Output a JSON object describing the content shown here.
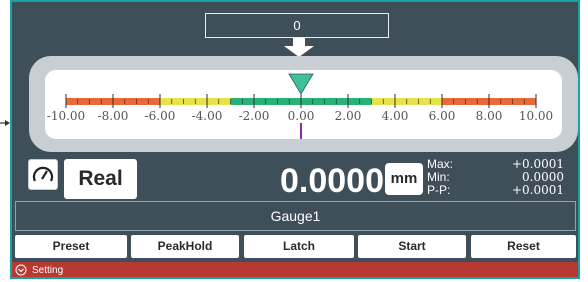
{
  "top_value": "0",
  "scale": {
    "min": -10,
    "max": 10,
    "major_ticks": [
      "-10.00",
      "-8.00",
      "-6.00",
      "-4.00",
      "-2.00",
      "0.00",
      "2.00",
      "4.00",
      "6.00",
      "8.00",
      "10.00"
    ],
    "zones": [
      {
        "from": -10,
        "to": -6,
        "color": "#e86a3a"
      },
      {
        "from": -6,
        "to": -3,
        "color": "#e6e24a"
      },
      {
        "from": -3,
        "to": 3,
        "color": "#28b27a"
      },
      {
        "from": 3,
        "to": 6,
        "color": "#e6e24a"
      },
      {
        "from": 6,
        "to": 10,
        "color": "#e86a3a"
      }
    ],
    "pointer_value": 0,
    "pointer_color": "#3fbf9a",
    "marker_color": "#8a2aa0"
  },
  "mode_label": "Real",
  "reading": "0.0000",
  "unit": "mm",
  "stats": {
    "max_label": "Max:",
    "max_value": "+0.0001",
    "min_label": "Min:",
    "min_value": "0.0000",
    "pp_label": "P-P:",
    "pp_value": "+0.0001"
  },
  "gauge_name": "Gauge1",
  "actions": {
    "preset": "Preset",
    "peakhold": "PeakHold",
    "latch": "Latch",
    "start": "Start",
    "reset": "Reset"
  },
  "setting_label": "Setting",
  "icons": {
    "gauge": "speedometer-icon",
    "setting": "chevron-down-circle-icon"
  }
}
